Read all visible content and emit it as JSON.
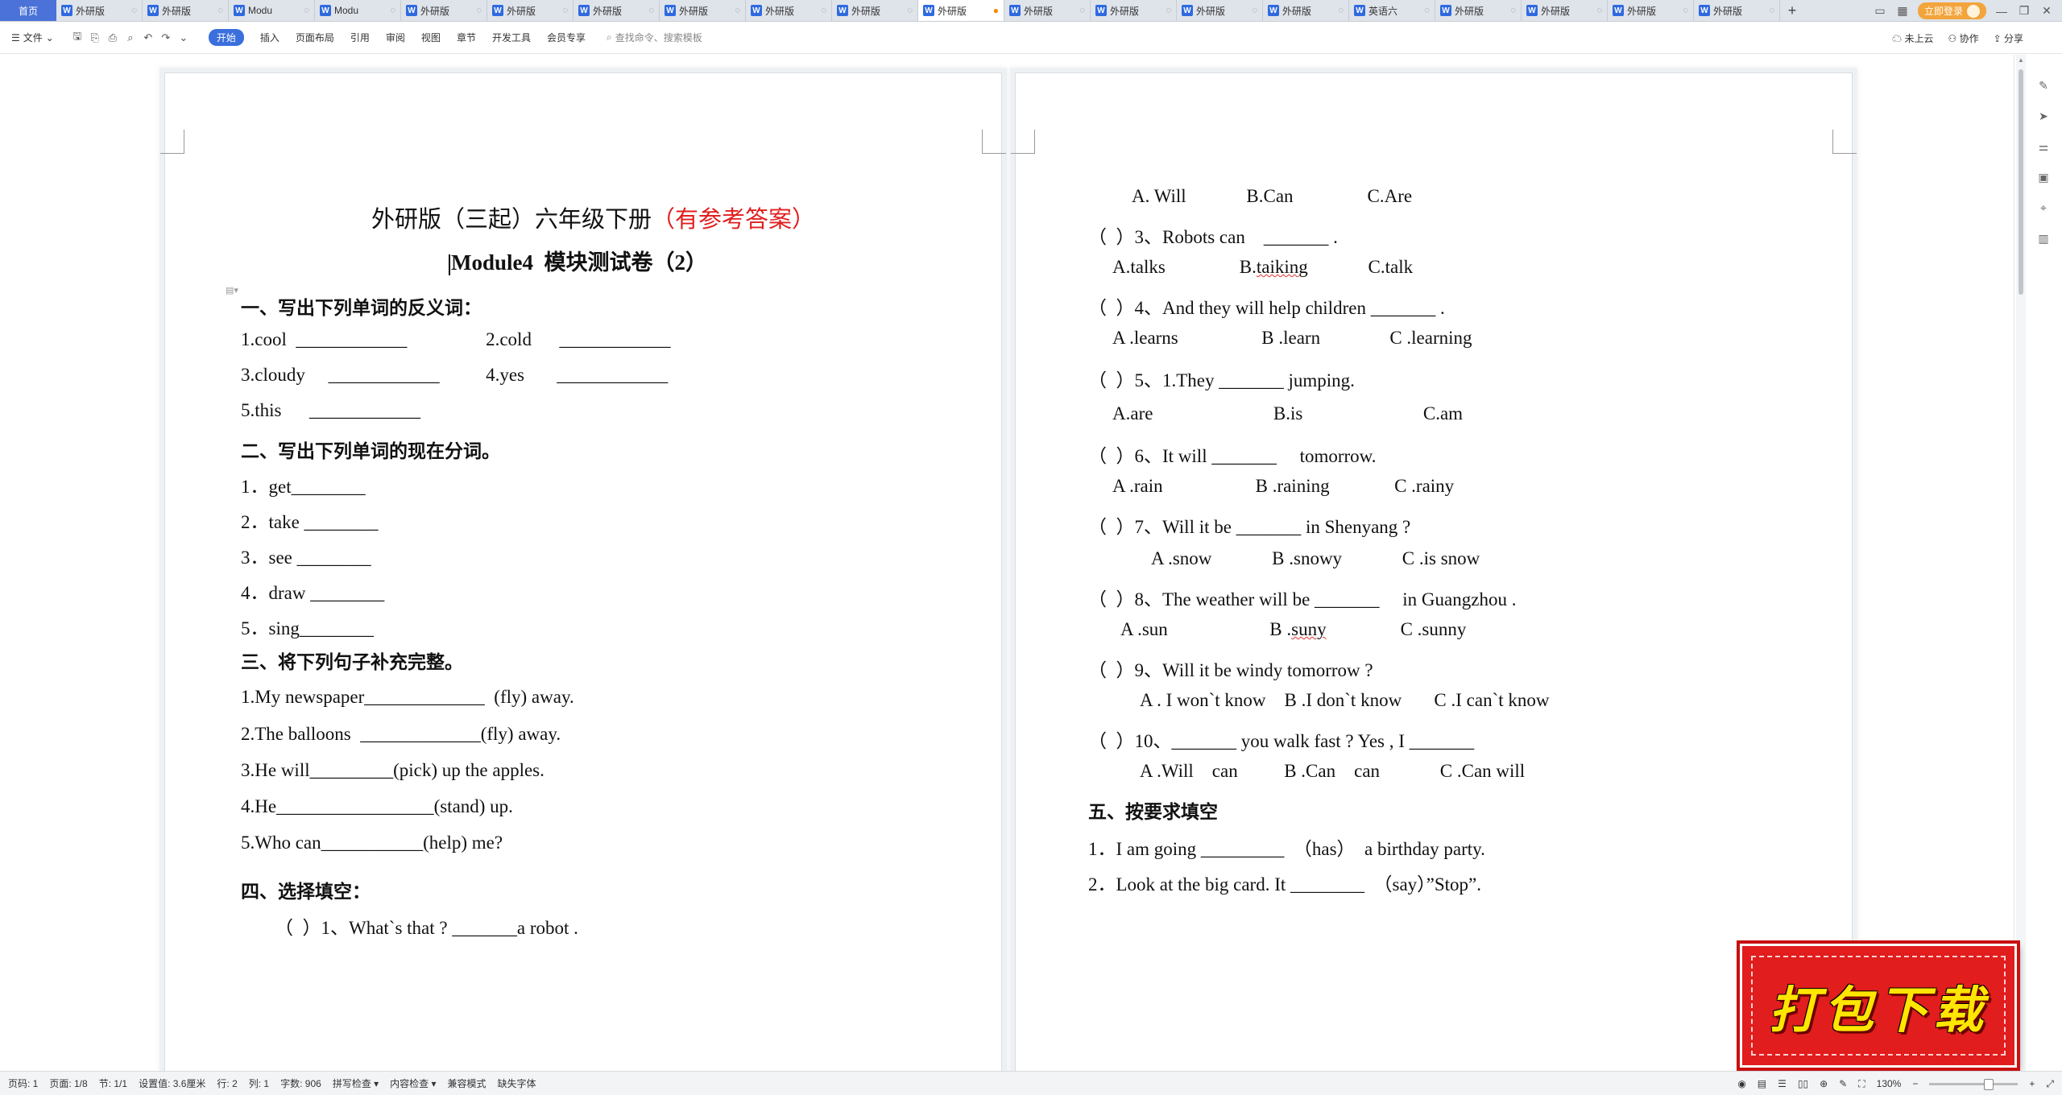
{
  "tabbar": {
    "home_label": "首页",
    "tabs": [
      {
        "title": "外研版"
      },
      {
        "title": "外研版"
      },
      {
        "title": "Modu"
      },
      {
        "title": "Modu"
      },
      {
        "title": "外研版"
      },
      {
        "title": "外研版"
      },
      {
        "title": "外研版"
      },
      {
        "title": "外研版"
      },
      {
        "title": "外研版"
      },
      {
        "title": "外研版"
      },
      {
        "title": "外研版"
      },
      {
        "title": "外研版"
      },
      {
        "title": "外研版"
      },
      {
        "title": "外研版"
      },
      {
        "title": "外研版"
      },
      {
        "title": "英语六"
      },
      {
        "title": "外研版"
      },
      {
        "title": "外研版"
      },
      {
        "title": "外研版"
      },
      {
        "title": "外研版"
      }
    ],
    "active_index": 10,
    "login_label": "立即登录"
  },
  "menu": {
    "file_label": "文件",
    "items": [
      "开始",
      "插入",
      "页面布局",
      "引用",
      "审阅",
      "视图",
      "章节",
      "开发工具",
      "会员专享"
    ],
    "active_item": "开始",
    "search_placeholder": "查找命令、搜索模板",
    "right": [
      "未上云",
      "协作",
      "分享"
    ]
  },
  "left_page": {
    "title_main": "外研版（三起）六年级下册",
    "title_red": "（有参考答案）",
    "subtitle": "Module4  模块测试卷（2）",
    "lines": [
      {
        "text": "一、写出下列单词的反义词：",
        "heading": true
      },
      {
        "text": "1.cool  ____________                 2.cold      ____________"
      },
      {
        "text": "3.cloudy     ____________          4.yes       ____________"
      },
      {
        "text": "5.this      ____________"
      },
      {
        "text": "二、写出下列单词的现在分词。",
        "heading": true
      },
      {
        "text": "1．get________"
      },
      {
        "text": "2．take ________"
      },
      {
        "text": "3．see ________"
      },
      {
        "text": "4．draw ________"
      },
      {
        "text": "5．sing________"
      },
      {
        "text": "三、将下列句子补充完整。",
        "heading": true
      },
      {
        "text": "1.My newspaper_____________  (fly) away."
      },
      {
        "text": "2.The balloons  _____________(fly) away."
      },
      {
        "text": "3.He will_________(pick) up the apples."
      },
      {
        "text": "4.He_________________(stand) up."
      },
      {
        "text": "5.Who can___________(help) me?"
      },
      {
        "text": "四、选择填空：",
        "heading": true
      },
      {
        "text": "（  ）1、What`s that ? _______a robot ."
      }
    ]
  },
  "right_page": {
    "lines": [
      {
        "text": "A. Will             B.Can                C.Are"
      },
      {
        "text": "（  ）3、Robots can    _______ ."
      },
      {
        "text": "A.talks                B.taiking             C.talk"
      },
      {
        "text": "（  ）4、And they will help children _______ ."
      },
      {
        "text": "A .learns                  B .learn               C .learning"
      },
      {
        "text": "（  ）5、1.They _______ jumping."
      },
      {
        "text": "A.are                          B.is                          C.am"
      },
      {
        "text": "（  ）6、It will _______     tomorrow."
      },
      {
        "text": "A .rain                    B .raining              C .rainy"
      },
      {
        "text": "（  ）7、Will it be _______ in Shenyang ?"
      },
      {
        "text": "A .snow             B .snowy             C .is snow"
      },
      {
        "text": "（  ）8、The weather will be _______     in Guangzhou ."
      },
      {
        "text": "A .sun                      B .suny                C .sunny"
      },
      {
        "text": "（  ）9、Will it be windy tomorrow ?"
      },
      {
        "text": "A . I won`t know    B .I don`t know       C .I can`t know"
      },
      {
        "text": "（  ）10、_______ you walk fast ? Yes , I _______"
      },
      {
        "text": "A .Will    can          B .Can    can             C .Can will"
      },
      {
        "text": "五、按要求填空",
        "heading": true
      },
      {
        "text": "1．I am going _________  （has）  a birthday party."
      },
      {
        "text": "2．Look at the big card. It ________  （say）”Stop”."
      }
    ]
  },
  "badge": {
    "text": "打包下载"
  },
  "statusbar": {
    "left": [
      "页码: 1",
      "页面: 1/8",
      "节: 1/1",
      "设置值: 3.6厘米",
      "行: 2",
      "列: 1",
      "字数: 906",
      "拼写检查 ▾",
      "内容检查 ▾",
      "兼容模式",
      "缺失字体"
    ],
    "zoom": "130%"
  },
  "colors": {
    "accent": "#3a6fdc",
    "title_red": "#e01f1f",
    "badge_red": "#e11d1d",
    "badge_text": "#ffe600"
  }
}
